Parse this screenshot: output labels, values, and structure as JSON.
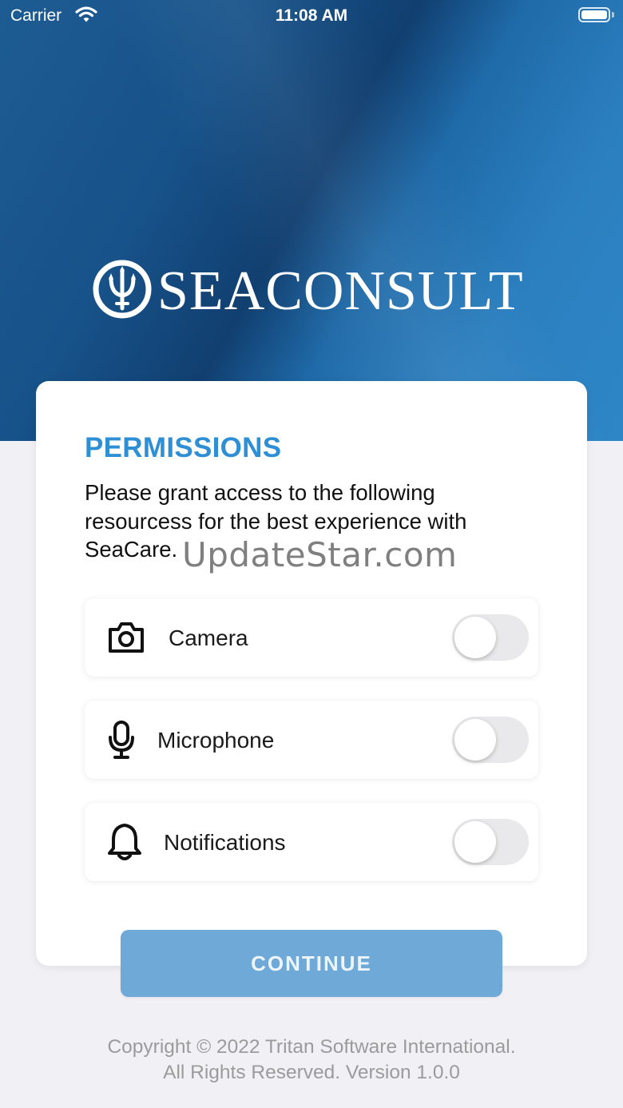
{
  "status_bar": {
    "carrier": "Carrier",
    "time": "11:08 AM",
    "icons": [
      "wifi-icon",
      "battery-icon"
    ]
  },
  "brand": {
    "logo_text": "SEACONSULT",
    "logo_icon": "trident-icon"
  },
  "permissions": {
    "title": "PERMISSIONS",
    "description": "Please grant access to the following resourcess for the best experience with SeaCare.",
    "items": [
      {
        "label": "Camera",
        "icon": "camera-icon",
        "enabled": false
      },
      {
        "label": "Microphone",
        "icon": "microphone-icon",
        "enabled": false
      },
      {
        "label": "Notifications",
        "icon": "bell-icon",
        "enabled": false
      }
    ]
  },
  "actions": {
    "continue_label": "CONTINUE"
  },
  "footer": {
    "copyright_line1": "Copyright © 2022 Tritan Software International.",
    "copyright_line2": "All Rights Reserved. Version 1.0.0"
  },
  "watermark": "UpdateStar.com",
  "colors": {
    "accent": "#2f8fd4",
    "hero_dark": "#113f70",
    "hero_light": "#2e86c6",
    "button": "#6fa9d8",
    "toggle_off": "#e9e9eb",
    "background": "#f1f1f5"
  }
}
